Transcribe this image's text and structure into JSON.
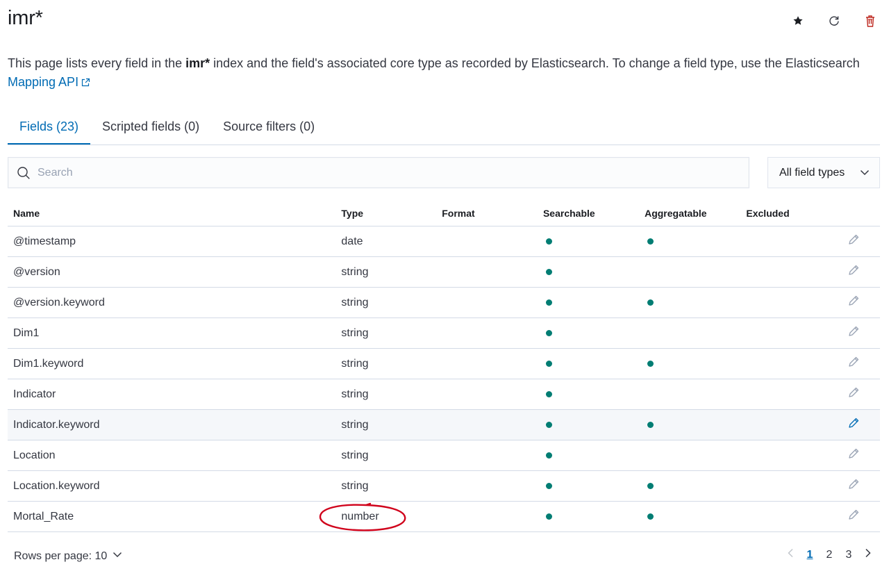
{
  "page": {
    "title": "imr*",
    "header_icons": [
      "star-icon",
      "refresh-icon",
      "delete-icon"
    ]
  },
  "description": {
    "before": "This page lists every field in the ",
    "index": "imr*",
    "after": " index and the field's associated core type as recorded by Elasticsearch. To change a field type, use the Elasticsearch ",
    "link": "Mapping API"
  },
  "tabs": [
    {
      "label": "Fields (23)",
      "active": true
    },
    {
      "label": "Scripted fields (0)",
      "active": false
    },
    {
      "label": "Source filters (0)",
      "active": false
    }
  ],
  "search": {
    "placeholder": "Search",
    "value": ""
  },
  "field_type_filter": {
    "selected": "All field types"
  },
  "table": {
    "headers": [
      "Name",
      "Type",
      "Format",
      "Searchable",
      "Aggregatable",
      "Excluded"
    ],
    "rows": [
      {
        "name": "@timestamp",
        "type": "date",
        "format": "",
        "searchable": true,
        "aggregatable": true,
        "excluded": false
      },
      {
        "name": "@version",
        "type": "string",
        "format": "",
        "searchable": true,
        "aggregatable": false,
        "excluded": false
      },
      {
        "name": "@version.keyword",
        "type": "string",
        "format": "",
        "searchable": true,
        "aggregatable": true,
        "excluded": false
      },
      {
        "name": "Dim1",
        "type": "string",
        "format": "",
        "searchable": true,
        "aggregatable": false,
        "excluded": false
      },
      {
        "name": "Dim1.keyword",
        "type": "string",
        "format": "",
        "searchable": true,
        "aggregatable": true,
        "excluded": false
      },
      {
        "name": "Indicator",
        "type": "string",
        "format": "",
        "searchable": true,
        "aggregatable": false,
        "excluded": false
      },
      {
        "name": "Indicator.keyword",
        "type": "string",
        "format": "",
        "searchable": true,
        "aggregatable": true,
        "excluded": false,
        "hovered": true
      },
      {
        "name": "Location",
        "type": "string",
        "format": "",
        "searchable": true,
        "aggregatable": false,
        "excluded": false
      },
      {
        "name": "Location.keyword",
        "type": "string",
        "format": "",
        "searchable": true,
        "aggregatable": true,
        "excluded": false
      },
      {
        "name": "Mortal_Rate",
        "type": "number",
        "format": "",
        "searchable": true,
        "aggregatable": true,
        "excluded": false,
        "annotated": true
      }
    ]
  },
  "pagination": {
    "rows_per_page_label": "Rows per page: 10",
    "pages": [
      "1",
      "2",
      "3"
    ],
    "current": "1"
  },
  "colors": {
    "accent": "#006bb4",
    "dot": "#017d73",
    "delete": "#bd271e",
    "annotation": "#d0021b"
  }
}
